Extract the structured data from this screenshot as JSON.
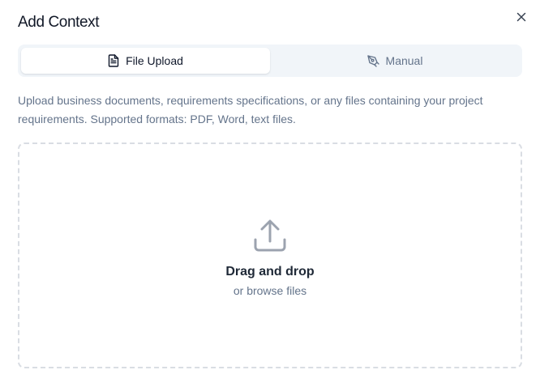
{
  "dialog": {
    "title": "Add Context",
    "close_icon": "close-icon"
  },
  "tabs": [
    {
      "label": "File Upload",
      "icon": "file-text-icon",
      "active": true
    },
    {
      "label": "Manual",
      "icon": "pen-tool-icon",
      "active": false
    }
  ],
  "description": "Upload business documents, requirements specifications, or any files containing your project requirements. Supported formats: PDF, Word, text files.",
  "dropzone": {
    "icon": "upload-icon",
    "title": "Drag and drop",
    "subtitle": "or browse files"
  },
  "colors": {
    "title_text": "#111827",
    "muted_text": "#64748b",
    "tab_track": "#f1f5f9",
    "dashed_border": "#d9dde3",
    "icon_gray": "#9ca3af"
  }
}
